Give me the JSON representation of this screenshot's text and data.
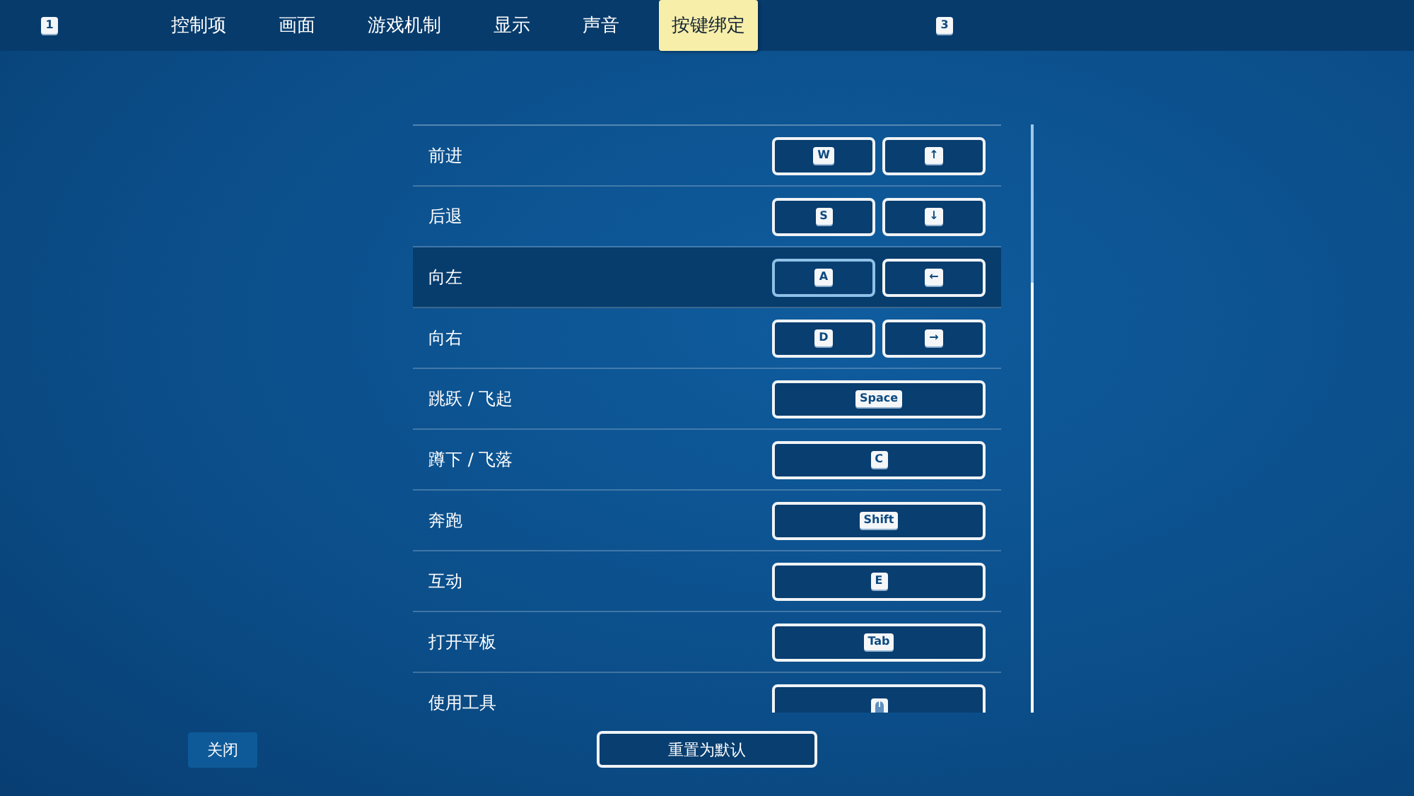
{
  "tabs_bar": {
    "prev_key": "1",
    "next_key": "3",
    "tabs": [
      {
        "label": "控制项",
        "selected": false
      },
      {
        "label": "画面",
        "selected": false
      },
      {
        "label": "游戏机制",
        "selected": false
      },
      {
        "label": "显示",
        "selected": false
      },
      {
        "label": "声音",
        "selected": false
      },
      {
        "label": "按键绑定",
        "selected": true
      }
    ]
  },
  "bindings": [
    {
      "action": "前进",
      "selected": false,
      "keys": [
        {
          "kind": "key",
          "label": "W",
          "focused": false
        },
        {
          "kind": "key",
          "label": "↑",
          "focused": false
        }
      ]
    },
    {
      "action": "后退",
      "selected": false,
      "keys": [
        {
          "kind": "key",
          "label": "S",
          "focused": false
        },
        {
          "kind": "key",
          "label": "↓",
          "focused": false
        }
      ]
    },
    {
      "action": "向左",
      "selected": true,
      "keys": [
        {
          "kind": "key",
          "label": "A",
          "focused": true
        },
        {
          "kind": "key",
          "label": "←",
          "focused": false
        }
      ]
    },
    {
      "action": "向右",
      "selected": false,
      "keys": [
        {
          "kind": "key",
          "label": "D",
          "focused": false
        },
        {
          "kind": "key",
          "label": "→",
          "focused": false
        }
      ]
    },
    {
      "action": "跳跃 / 飞起",
      "selected": false,
      "keys": [
        {
          "kind": "key",
          "label": "Space",
          "focused": false
        }
      ]
    },
    {
      "action": "蹲下 / 飞落",
      "selected": false,
      "keys": [
        {
          "kind": "key",
          "label": "C",
          "focused": false
        }
      ]
    },
    {
      "action": "奔跑",
      "selected": false,
      "keys": [
        {
          "kind": "key",
          "label": "Shift",
          "focused": false
        }
      ]
    },
    {
      "action": "互动",
      "selected": false,
      "keys": [
        {
          "kind": "key",
          "label": "E",
          "focused": false
        }
      ]
    },
    {
      "action": "打开平板",
      "selected": false,
      "keys": [
        {
          "kind": "key",
          "label": "Tab",
          "focused": false
        }
      ]
    },
    {
      "action": "使用工具",
      "selected": false,
      "keys": [
        {
          "kind": "mouse",
          "focused": false
        }
      ]
    }
  ],
  "footer": {
    "close": "关闭",
    "reset": "重置为默认"
  }
}
